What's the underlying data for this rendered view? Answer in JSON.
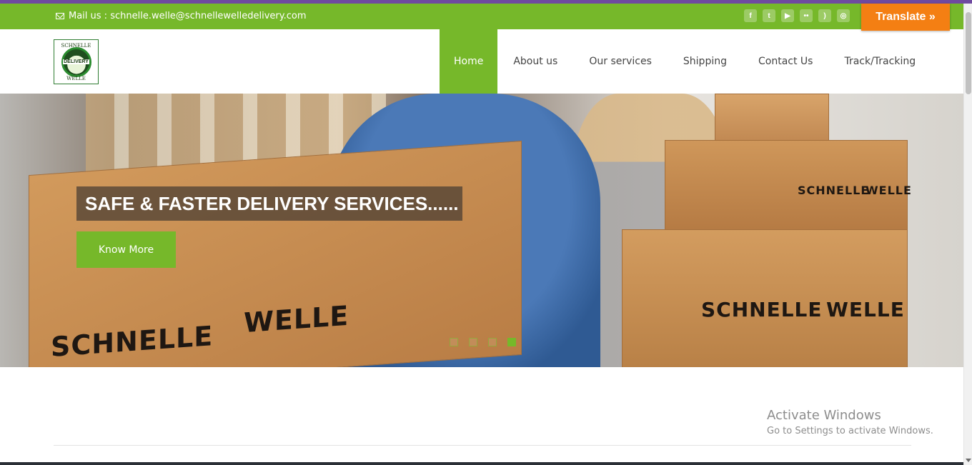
{
  "topbar": {
    "mail_text": "Mail us : schnelle.welle@schnellewelledelivery.com",
    "social_icons": [
      "facebook-icon",
      "twitter-icon",
      "youtube-icon",
      "flickr-icon",
      "rss-icon",
      "instagram-icon"
    ],
    "translate_label": "Translate »"
  },
  "logo": {
    "arc_top": "SCHNELLE",
    "center": "DELIVERY",
    "arc_bottom": "WELLE"
  },
  "nav": {
    "items": [
      {
        "label": "Home",
        "active": true
      },
      {
        "label": "About us"
      },
      {
        "label": "Our services"
      },
      {
        "label": "Shipping"
      },
      {
        "label": "Contact Us"
      },
      {
        "label": "Track/Tracking"
      }
    ]
  },
  "hero": {
    "caption": "SAFE & FASTER DELIVERY SERVICES......",
    "button_label": "Know More",
    "box_marks": [
      "SCHNELLE",
      "WELLE"
    ],
    "slide_count": 4,
    "active_slide": 4
  },
  "watermark": {
    "title": "Activate Windows",
    "subtitle": "Go to Settings to activate Windows."
  },
  "colors": {
    "brand_green": "#76b82a",
    "translate_orange": "#f47f13"
  }
}
